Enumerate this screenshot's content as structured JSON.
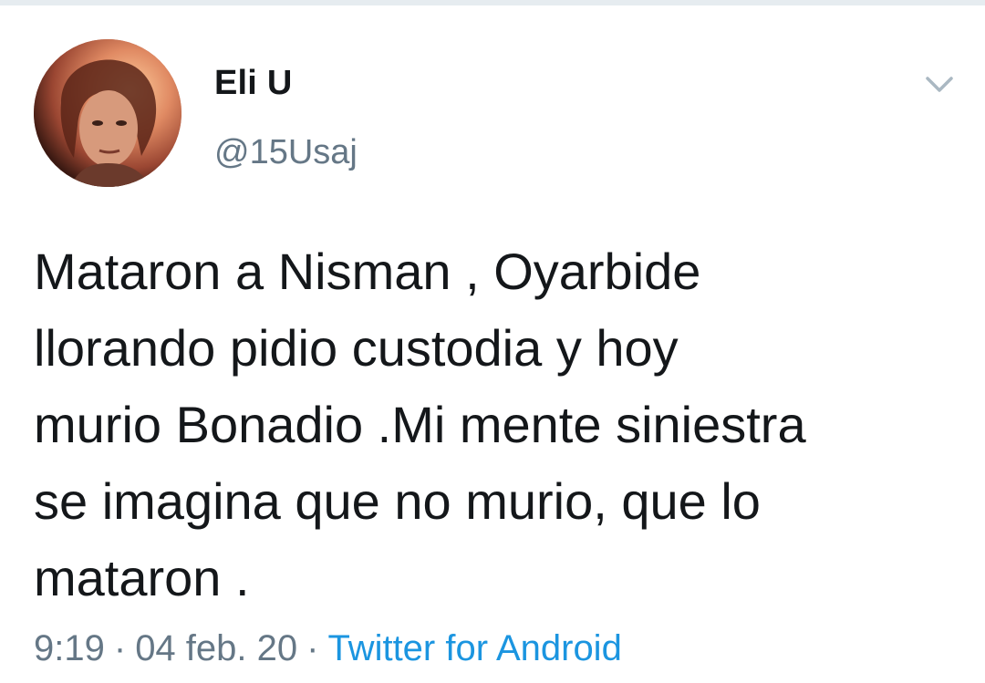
{
  "tweet": {
    "author": {
      "display_name": "Eli U",
      "handle": "@15Usaj",
      "avatar_icon": "user-avatar-photo"
    },
    "menu_icon": "chevron-down-icon",
    "text": "Mataron a Nisman , Oyarbide\nllorando pidio custodia y hoy\nmurio Bonadio .Mi mente siniestra\nse imagina que no murio, que lo\nmataron .",
    "time": "9:19",
    "date": "04 feb. 20",
    "separator": "·",
    "source": "Twitter for Android"
  },
  "colors": {
    "text_primary": "#14171a",
    "text_secondary": "#657786",
    "link": "#1b95e0",
    "divider": "#e6ecf0"
  }
}
